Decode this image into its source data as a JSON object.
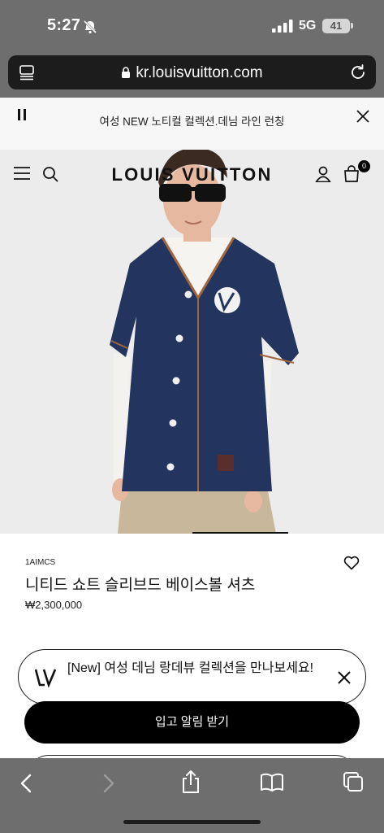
{
  "status_bar": {
    "time": "5:27",
    "network": "5G",
    "battery": "41"
  },
  "browser": {
    "url": "kr.louisvuitton.com"
  },
  "announcement": {
    "text": "여성 NEW 노티컬 컬렉션.데님 라인 런칭"
  },
  "header": {
    "logo": "LOUIS VUITTON",
    "bag_count": "0"
  },
  "hero": {
    "image_alt": "model wearing navy knitted baseball shirt"
  },
  "product": {
    "sku": "1AIMCS",
    "name": "니티드 쇼트 슬리브드 베이스볼 셔츠",
    "price": "₩2,300,000"
  },
  "toast": {
    "text": "[New] 여성 데님 랑데뷰 컬렉션을 만나보세요!"
  },
  "cta": {
    "label": "입고 알림 받기"
  },
  "colors": {
    "browser_chrome": "#6e6e6e",
    "url_bar": "#1c1c1c",
    "navy": "#23355f",
    "accent_stitch": "#a0663e"
  },
  "icons": [
    "bell-slash-icon",
    "signal-icon",
    "tabs-layout-icon",
    "lock-icon",
    "reload-icon",
    "pause-icon",
    "close-icon",
    "menu-icon",
    "search-icon",
    "account-icon",
    "bag-icon",
    "heart-icon",
    "lv-logo-icon",
    "back-icon",
    "forward-icon",
    "share-icon",
    "bookmarks-icon",
    "tabs-icon"
  ]
}
